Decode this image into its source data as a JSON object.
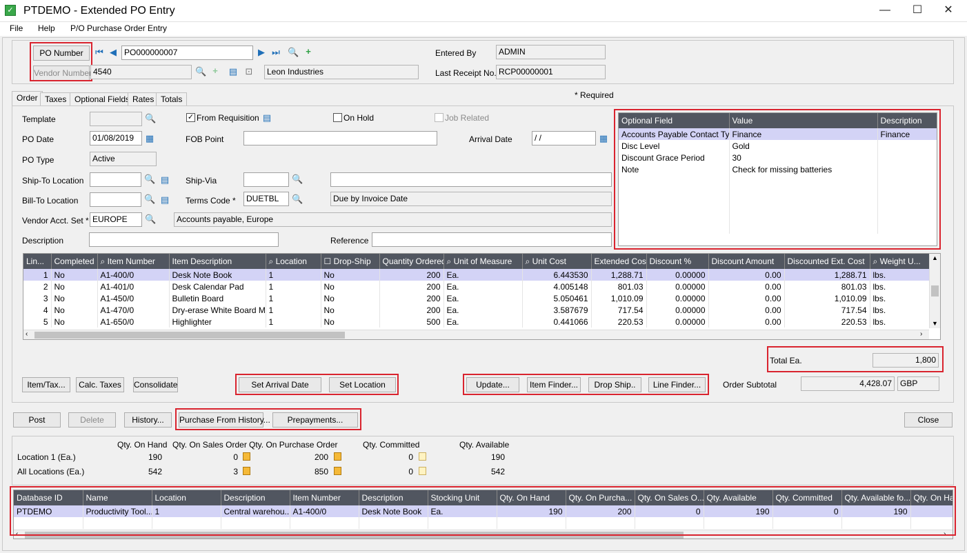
{
  "window": {
    "title": "PTDEMO - Extended PO Entry",
    "minimize": "—",
    "maximize": "☐",
    "close": "✕"
  },
  "menu": {
    "file": "File",
    "help": "Help",
    "po_entry": "P/O Purchase Order Entry"
  },
  "header": {
    "po_number_btn": "PO Number",
    "po_number": "PO000000007",
    "vendor_number_btn": "Vendor Number",
    "vendor_number": "4540",
    "vendor_name": "Leon Industries",
    "entered_by_label": "Entered By",
    "entered_by": "ADMIN",
    "last_receipt_label": "Last Receipt No.",
    "last_receipt": "RCP00000001",
    "required_note": "*  Required"
  },
  "tabs": [
    "Order",
    "Taxes",
    "Optional Fields",
    "Rates",
    "Totals"
  ],
  "order": {
    "template_label": "Template",
    "template": "",
    "from_requisition": "From Requisition",
    "on_hold": "On Hold",
    "job_related": "Job Related",
    "po_date_label": "PO Date",
    "po_date": "01/08/2019",
    "fob_label": "FOB Point",
    "fob": "",
    "arrival_label": "Arrival Date",
    "arrival": " / /",
    "po_type_label": "PO Type",
    "po_type": "Active",
    "shipto_label": "Ship-To Location",
    "shipto": "",
    "shipvia_label": "Ship-Via",
    "shipvia": "",
    "shipvia_desc": "",
    "billto_label": "Bill-To Location",
    "billto": "",
    "terms_label": "Terms Code *",
    "terms": "DUETBL",
    "terms_desc": "Due by Invoice Date",
    "acctset_label": "Vendor Acct. Set *",
    "acctset": "EUROPE",
    "acctset_desc": "Accounts payable, Europe",
    "description_label": "Description",
    "description": "",
    "reference_label": "Reference",
    "reference": ""
  },
  "optional_fields": {
    "headers": [
      "Optional Field",
      "Value",
      "Description"
    ],
    "rows": [
      [
        "Accounts Payable Contact Type",
        "Finance",
        "Finance"
      ],
      [
        "Disc Level",
        "Gold",
        ""
      ],
      [
        "Discount Grace Period",
        "30",
        ""
      ],
      [
        "Note",
        "Check for missing batteries",
        ""
      ]
    ]
  },
  "lines": {
    "headers": [
      "Lin...",
      "Completed",
      "Item Number",
      "Item Description",
      "Location",
      "Drop-Ship",
      "Quantity Ordered",
      "Unit of Measure",
      "Unit Cost",
      "Extended Cost",
      "Discount %",
      "Discount Amount",
      "Discounted Ext. Cost",
      "Weight U..."
    ],
    "rows": [
      [
        "1",
        "No",
        "A1-400/0",
        "Desk Note Book",
        "1",
        "No",
        "200",
        "Ea.",
        "6.443530",
        "1,288.71",
        "0.00000",
        "0.00",
        "1,288.71",
        "lbs."
      ],
      [
        "2",
        "No",
        "A1-401/0",
        "Desk Calendar Pad",
        "1",
        "No",
        "200",
        "Ea.",
        "4.005148",
        "801.03",
        "0.00000",
        "0.00",
        "801.03",
        "lbs."
      ],
      [
        "3",
        "No",
        "A1-450/0",
        "Bulletin Board",
        "1",
        "No",
        "200",
        "Ea.",
        "5.050461",
        "1,010.09",
        "0.00000",
        "0.00",
        "1,010.09",
        "lbs."
      ],
      [
        "4",
        "No",
        "A1-470/0",
        "Dry-erase White Board M...",
        "1",
        "No",
        "200",
        "Ea.",
        "3.587679",
        "717.54",
        "0.00000",
        "0.00",
        "717.54",
        "lbs."
      ],
      [
        "5",
        "No",
        "A1-650/0",
        "Highlighter",
        "1",
        "No",
        "500",
        "Ea.",
        "0.441066",
        "220.53",
        "0.00000",
        "0.00",
        "220.53",
        "lbs."
      ]
    ]
  },
  "totals": {
    "total_ea_label": "Total Ea.",
    "total_ea": "1,800",
    "subtotal_label": "Order Subtotal",
    "subtotal": "4,428.07",
    "currency": "GBP"
  },
  "buttons": {
    "item_tax": "Item/Tax...",
    "calc_taxes": "Calc. Taxes",
    "consolidate": "Consolidate",
    "set_arrival": "Set Arrival Date",
    "set_location": "Set Location",
    "update": "Update...",
    "item_finder": "Item Finder...",
    "drop_ship": "Drop Ship..",
    "line_finder": "Line Finder...",
    "post": "Post",
    "delete": "Delete",
    "history": "History...",
    "purchase_history": "Purchase From History...",
    "prepayments": "Prepayments...",
    "close": "Close"
  },
  "qty": {
    "headers": [
      "Qty. On Hand",
      "Qty. On Sales Order",
      "Qty. On Purchase Order",
      "Qty. Committed",
      "Qty. Available"
    ],
    "rows": [
      {
        "label": "Location 1 (Ea.)",
        "on_hand": "190",
        "on_so": "0",
        "on_po": "200",
        "committed": "0",
        "available": "190"
      },
      {
        "label": "All Locations  (Ea.)",
        "on_hand": "542",
        "on_so": "3",
        "on_po": "850",
        "committed": "0",
        "available": "542"
      }
    ]
  },
  "db_grid": {
    "headers": [
      "Database ID",
      "Name",
      "Location",
      "Description",
      "Item Number",
      "Description",
      "Stocking Unit",
      "Qty. On Hand",
      "Qty. On Purcha...",
      "Qty. On Sales O...",
      "Qty. Available",
      "Qty. Committed",
      "Qty. Available fo...",
      "Qty. On Han"
    ],
    "rows": [
      [
        "PTDEMO",
        "Productivity Tool...",
        "1",
        "Central warehou...",
        "A1-400/0",
        "Desk Note Book",
        "Ea.",
        "190",
        "200",
        "0",
        "190",
        "0",
        "190",
        ""
      ]
    ]
  }
}
